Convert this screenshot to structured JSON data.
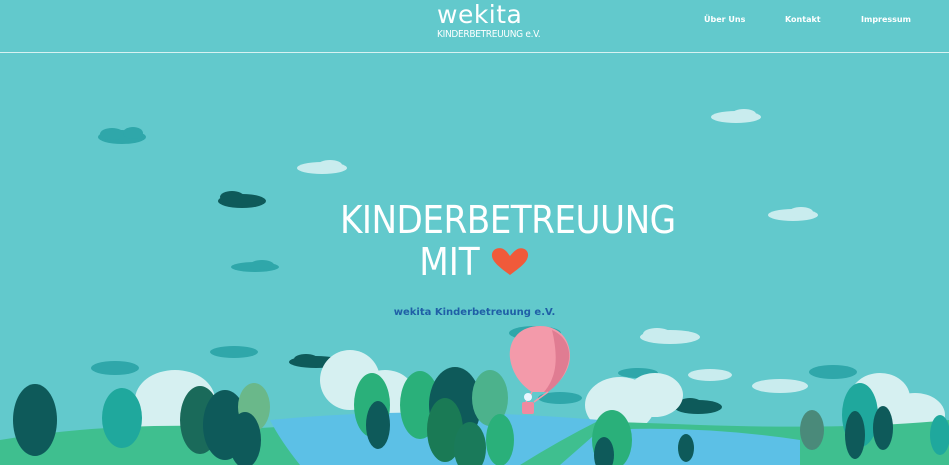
{
  "header": {
    "logo_word": "wekita",
    "logo_sub": "KINDERBETREUUNG e.V.",
    "nav": [
      {
        "label": "Über Uns"
      },
      {
        "label": "Kontakt"
      },
      {
        "label": "Impressum"
      }
    ]
  },
  "hero": {
    "line1": "KINDERBETREUUNG",
    "line2": "MIT",
    "subtitle": "wekita Kinderbetreuung e.V."
  },
  "colors": {
    "sky": "#62c9cc",
    "heart": "#f05a3a",
    "subtitle": "#1f5fa6",
    "dark_tree": "#0e5a5a",
    "balloon": "#f39aaa"
  }
}
